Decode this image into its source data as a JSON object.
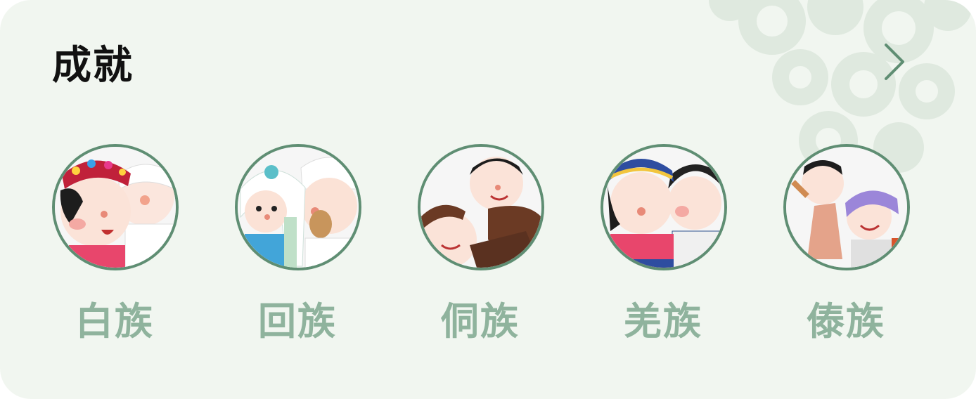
{
  "section": {
    "title": "成就",
    "more_icon": "chevron-right-icon",
    "background_ornament": "cloud-scroll-ornament"
  },
  "colors": {
    "card_background": "#f1f6f0",
    "avatar_border": "#5f8e73",
    "label": "#8fb39d",
    "title": "#111111"
  },
  "achievements": [
    {
      "label": "白族",
      "icon": "bai-ethnic-avatar"
    },
    {
      "label": "回族",
      "icon": "hui-ethnic-avatar"
    },
    {
      "label": "侗族",
      "icon": "dong-ethnic-avatar"
    },
    {
      "label": "羌族",
      "icon": "qiang-ethnic-avatar"
    },
    {
      "label": "傣族",
      "icon": "dai-ethnic-avatar"
    }
  ]
}
